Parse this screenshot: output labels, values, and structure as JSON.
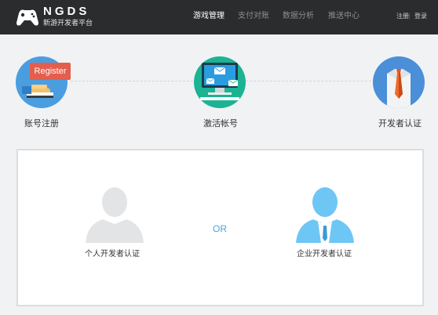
{
  "header": {
    "logo_text": "NGDS",
    "logo_subtitle": "新游开发者平台",
    "nav": [
      {
        "label": "游戏管理",
        "active": true
      },
      {
        "label": "支付对账",
        "active": false
      },
      {
        "label": "数据分析",
        "active": false
      },
      {
        "label": "推送中心",
        "active": false
      }
    ],
    "login_label": "注册",
    "separator": "|",
    "register_label": "登录"
  },
  "steps": [
    {
      "label": "账号注册",
      "badge": "Register",
      "icon": "register-hand-icon"
    },
    {
      "label": "激活帐号",
      "icon": "email-monitor-icon"
    },
    {
      "label": "开发者认证",
      "icon": "tie-suit-icon"
    }
  ],
  "choices": {
    "personal_label": "个人开发者认证",
    "or_label": "OR",
    "enterprise_label": "企业开发者认证"
  },
  "colors": {
    "header_bg": "#2b2c2e",
    "accent_blue": "#4aa3d8",
    "badge_red": "#e45e4e",
    "step1_bg": "#4a9ee0",
    "step2_bg": "#1bb394",
    "step3_bg": "#4a8fd8"
  }
}
